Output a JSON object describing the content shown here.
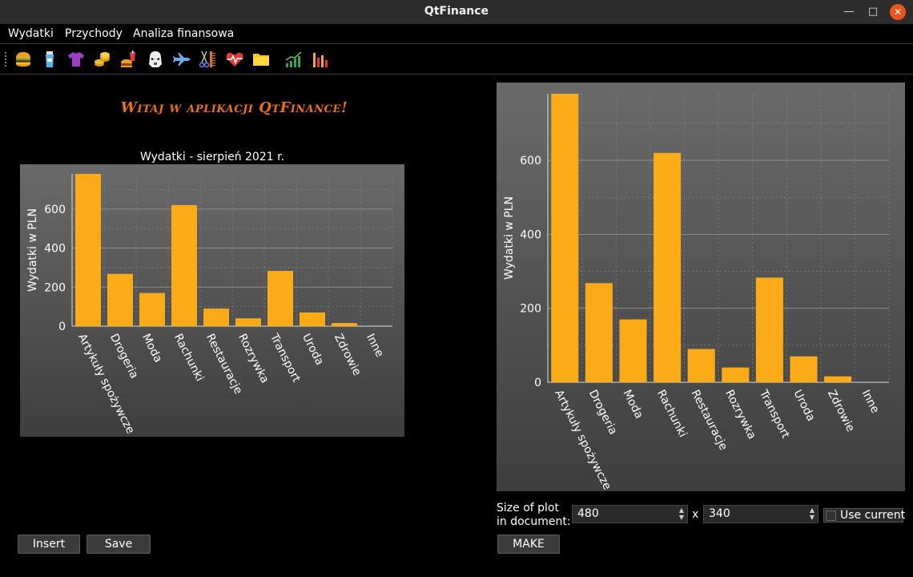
{
  "window": {
    "title": "QtFinance"
  },
  "menu": [
    "Wydatki",
    "Przychody",
    "Analiza finansowa"
  ],
  "toolbar": {
    "icons": [
      "burger-icon",
      "bottle-icon",
      "tshirt-icon",
      "coins-icon",
      "fast-food-icon",
      "stormtrooper-icon",
      "airplane-icon",
      "scissors-comb-icon",
      "heart-pulse-icon",
      "folder-icon",
      "growth-chart-icon",
      "bar-chart-icon"
    ]
  },
  "welcome": "Witaj w aplikacji QtFinance!",
  "left_chart_title": "Wydatki - sierpień 2021 r.",
  "chart_data": [
    {
      "type": "bar",
      "title": "Wydatki - sierpień 2021 r.",
      "ylabel": "Wydatki w PLN",
      "categories": [
        "Artykuły spożywcze",
        "Drogeria",
        "Moda",
        "Rachunki",
        "Restauracje",
        "Rozrywka",
        "Transport",
        "Uroda",
        "Zdrowie",
        "Inne"
      ],
      "values": [
        780,
        268,
        170,
        620,
        90,
        40,
        283,
        70,
        16,
        0
      ],
      "yticks": [
        0,
        200,
        400,
        600
      ],
      "ylim": [
        0,
        780
      ],
      "grid": true,
      "color": "#fbab18"
    },
    {
      "type": "bar",
      "ylabel": "Wydatki w PLN",
      "categories": [
        "Artykuły spożywcze",
        "Drogeria",
        "Moda",
        "Rachunki",
        "Restauracje",
        "Rozrywka",
        "Transport",
        "Uroda",
        "Zdrowie",
        "Inne"
      ],
      "values": [
        780,
        268,
        170,
        620,
        90,
        40,
        283,
        70,
        16,
        0
      ],
      "yticks": [
        0,
        200,
        400,
        600
      ],
      "ylim": [
        0,
        780
      ],
      "grid": true,
      "color": "#fbab18"
    }
  ],
  "buttons": {
    "insert": "Insert",
    "save": "Save",
    "make": "MAKE"
  },
  "size_panel": {
    "label_line1": "Size of plot",
    "label_line2": "in document:",
    "width": "480",
    "height": "340",
    "x": "x",
    "use_current": "Use current"
  },
  "colors": {
    "accent": "#e8711c",
    "bar": "#fbab18",
    "close": "#e95420"
  }
}
